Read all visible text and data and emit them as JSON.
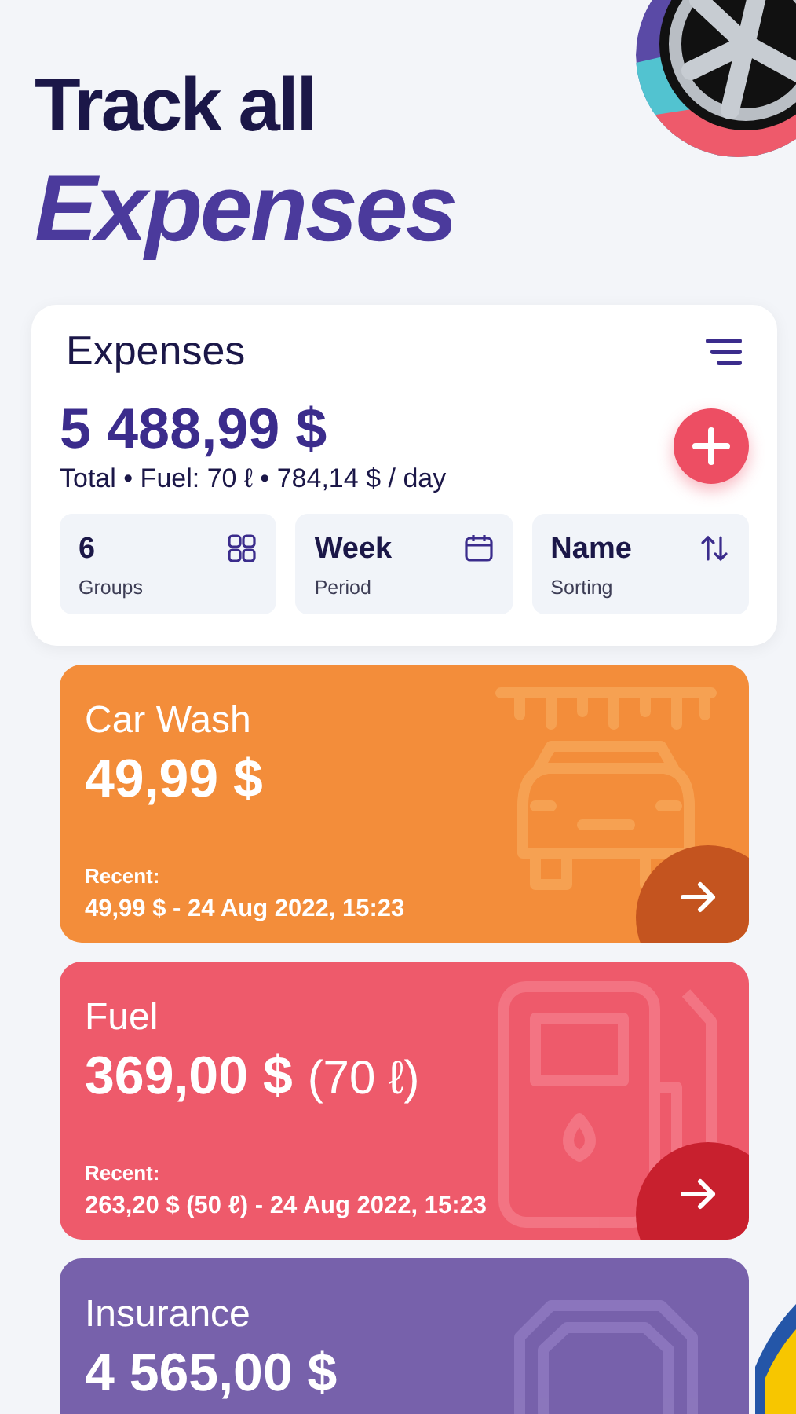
{
  "headline": {
    "line_1": "Track all",
    "line_2": "Expenses"
  },
  "panel": {
    "title": "Expenses",
    "total": "5 488,99 $",
    "summary": "Total • Fuel: 70 ℓ • 784,14 $ / day",
    "tiles": [
      {
        "kind": "groups",
        "value": "6",
        "label": "Groups"
      },
      {
        "kind": "period",
        "value": "Week",
        "label": "Period"
      },
      {
        "kind": "sorting",
        "value": "Name",
        "label": "Sorting"
      }
    ],
    "categories": [
      {
        "kind": "car-wash",
        "color": "#f38d3a",
        "name": "Car Wash",
        "amount": "49,99 $",
        "recent_label": "Recent:",
        "recent": "49,99 $ - 24 Aug 2022, 15:23"
      },
      {
        "kind": "fuel",
        "color": "#ee5a6b",
        "name": "Fuel",
        "amount": "369,00 $",
        "volume": "(70 ℓ)",
        "recent_label": "Recent:",
        "recent": "263,20 $ (50 ℓ) - 24 Aug 2022, 15:23"
      },
      {
        "kind": "insurance",
        "color": "#7761ab",
        "name": "Insurance",
        "amount": "4 565,00 $"
      }
    ]
  }
}
